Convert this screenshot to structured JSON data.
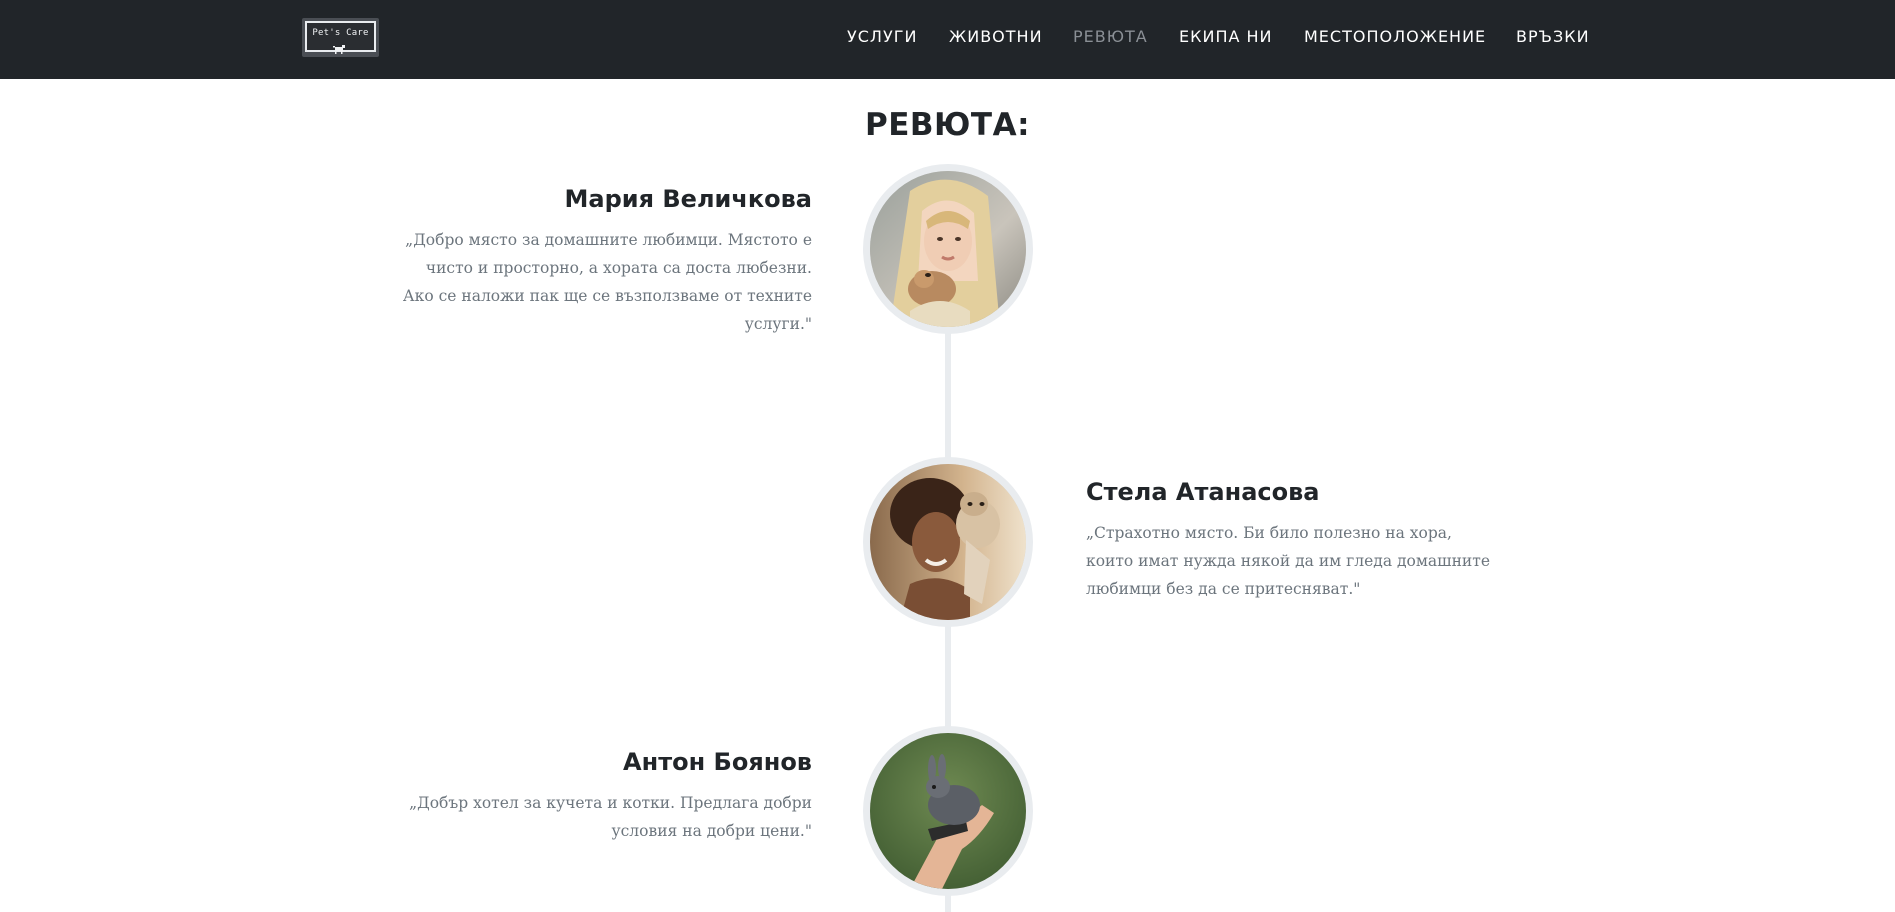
{
  "navbar": {
    "logo_text": "Pet's Care",
    "links": [
      {
        "label": "УСЛУГИ",
        "active": false
      },
      {
        "label": "ЖИВОТНИ",
        "active": false
      },
      {
        "label": "РЕВЮТА",
        "active": true
      },
      {
        "label": "ЕКИПА НИ",
        "active": false
      },
      {
        "label": "МЕСТОПОЛОЖЕНИЕ",
        "active": false
      },
      {
        "label": "ВРЪЗКИ",
        "active": false
      }
    ]
  },
  "reviews_section": {
    "title": "РЕВЮТА:",
    "reviews": [
      {
        "name": "Мария Величкова",
        "text": "„Добро място за домашните любимци. Мястото е чисто и просторно, а хората са доста любезни. Ако се наложи пак ще се възползваме от техните услуги.\"",
        "photo": "woman with headscarf holding small dog"
      },
      {
        "name": "Стела Атанасова",
        "text": "„Страхотно място. Би било полезно на хора, които имат нужда някой да им гледа домашните любимци без да се притесняват.\"",
        "photo": "woman smiling holding puppy"
      },
      {
        "name": "Антон Боянов",
        "text": "„Добър хотел за кучета и котки. Предлага добри условия на добри цени.\"",
        "photo": "hand holding grey rabbit"
      }
    ]
  },
  "colors": {
    "navbar_bg": "#212529",
    "nav_active": "#8a8f95",
    "heading": "#212529",
    "body_text": "#6c757d",
    "timeline": "#e9ecef"
  }
}
